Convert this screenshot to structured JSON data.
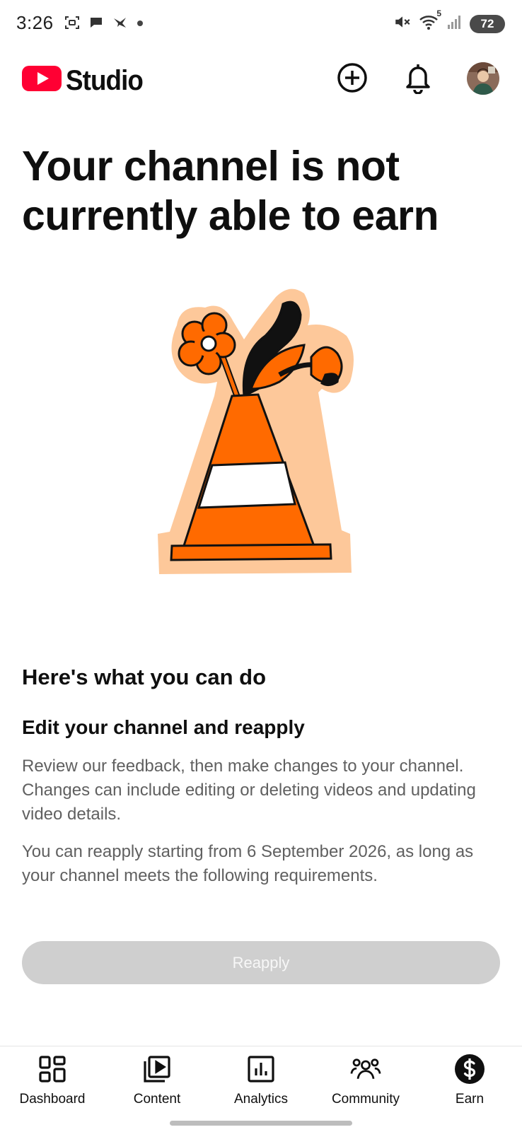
{
  "status_bar": {
    "time": "3:26",
    "network_label": "5",
    "battery": "72"
  },
  "header": {
    "app_name": "Studio",
    "brand_color": "#ff0033",
    "icons": [
      "create-icon",
      "notifications-icon",
      "avatar"
    ]
  },
  "main": {
    "title": "Your channel is not currently able to earn",
    "section_heading": "Here's what you can do",
    "sub_heading": "Edit your channel and reapply",
    "paragraph_1": "Review our feedback, then make changes to your channel. Changes can include editing or deleting videos and updating video details.",
    "paragraph_2": "You can reapply starting from 6 September 2026, as long as your channel meets the following requirements.",
    "reapply_label": "Reapply",
    "reapply_enabled": false
  },
  "bottom_nav": {
    "items": [
      {
        "label": "Dashboard",
        "icon": "dashboard-icon"
      },
      {
        "label": "Content",
        "icon": "content-icon"
      },
      {
        "label": "Analytics",
        "icon": "analytics-icon"
      },
      {
        "label": "Community",
        "icon": "community-icon"
      },
      {
        "label": "Earn",
        "icon": "earn-icon"
      }
    ],
    "selected": "Earn"
  }
}
